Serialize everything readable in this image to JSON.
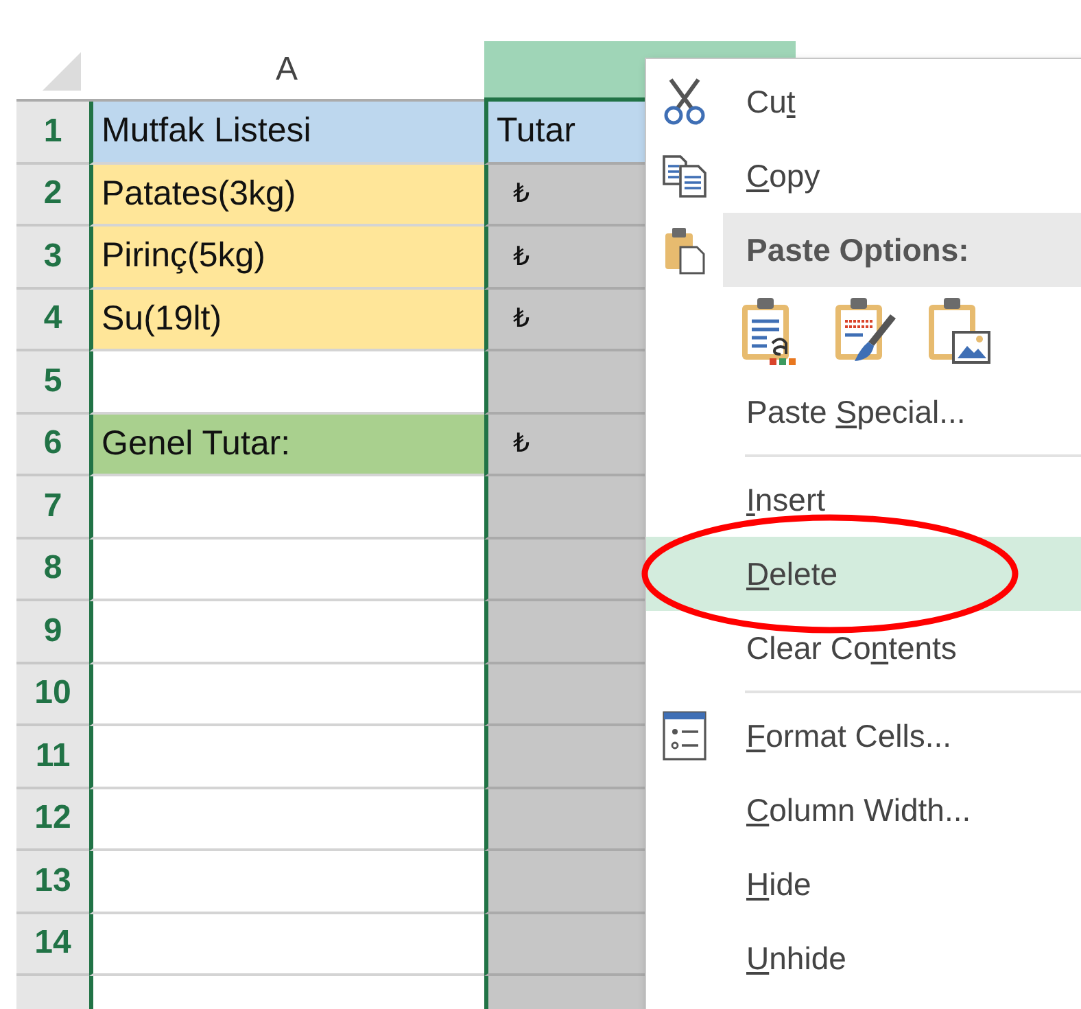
{
  "columns": [
    {
      "label": "A",
      "selected": false
    },
    {
      "selected": true
    }
  ],
  "rows": [
    {
      "number": "1",
      "cells": [
        {
          "text": "Mutfak Listesi",
          "color": "#bdd7ee"
        },
        {
          "text": "Tutar",
          "color": "#bdd7ee"
        }
      ]
    },
    {
      "number": "2",
      "cells": [
        {
          "text": "Patates(3kg)",
          "color": "#ffe699"
        },
        {
          "text": "₺"
        }
      ]
    },
    {
      "number": "3",
      "cells": [
        {
          "text": "Pirinç(5kg)",
          "color": "#ffe699"
        },
        {
          "text": "₺"
        }
      ]
    },
    {
      "number": "4",
      "cells": [
        {
          "text": "Su(19lt)",
          "color": "#ffe699"
        },
        {
          "text": "₺"
        }
      ]
    },
    {
      "number": "5",
      "cells": [
        {},
        {}
      ]
    },
    {
      "number": "6",
      "cells": [
        {
          "text": "Genel Tutar:",
          "color": "#a9d08e"
        },
        {
          "text": "₺"
        }
      ]
    },
    {
      "number": "7",
      "cells": [
        {},
        {}
      ]
    },
    {
      "number": "8",
      "cells": [
        {},
        {}
      ]
    },
    {
      "number": "9",
      "cells": [
        {},
        {}
      ]
    },
    {
      "number": "10",
      "cells": [
        {},
        {}
      ]
    },
    {
      "number": "11",
      "cells": [
        {},
        {}
      ]
    },
    {
      "number": "12",
      "cells": [
        {},
        {}
      ]
    },
    {
      "number": "13",
      "cells": [
        {},
        {}
      ]
    },
    {
      "number": "14",
      "cells": [
        {},
        {}
      ]
    },
    {
      "cells": [
        {},
        {}
      ]
    }
  ],
  "context_menu": [
    {
      "kind": "item",
      "pre": "Cu",
      "key": "t",
      "selected": false,
      "circled": false
    },
    {
      "kind": "item",
      "key": "C",
      "post": "opy",
      "selected": false,
      "circled": false
    },
    {
      "kind": "header",
      "label": "Paste Options:"
    },
    {
      "kind": "paste-icons"
    },
    {
      "kind": "item",
      "pre": "Paste ",
      "key": "S",
      "post": "pecial...",
      "selected": false,
      "circled": false
    },
    {
      "kind": "separator"
    },
    {
      "kind": "item",
      "key": "I",
      "post": "nsert",
      "selected": false,
      "circled": false
    },
    {
      "kind": "item",
      "key": "D",
      "post": "elete",
      "selected": true,
      "circled": true
    },
    {
      "kind": "item",
      "pre": "Clear Co",
      "key": "n",
      "post": "tents",
      "selected": false,
      "circled": false
    },
    {
      "kind": "separator"
    },
    {
      "kind": "item",
      "key": "F",
      "post": "ormat Cells...",
      "selected": false,
      "circled": false
    },
    {
      "kind": "item",
      "key": "C",
      "post": "olumn Width...",
      "selected": false,
      "circled": false
    },
    {
      "kind": "item",
      "key": "H",
      "post": "ide",
      "selected": false,
      "circled": false
    },
    {
      "kind": "item",
      "key": "U",
      "post": "nhide",
      "selected": false,
      "circled": false
    }
  ]
}
